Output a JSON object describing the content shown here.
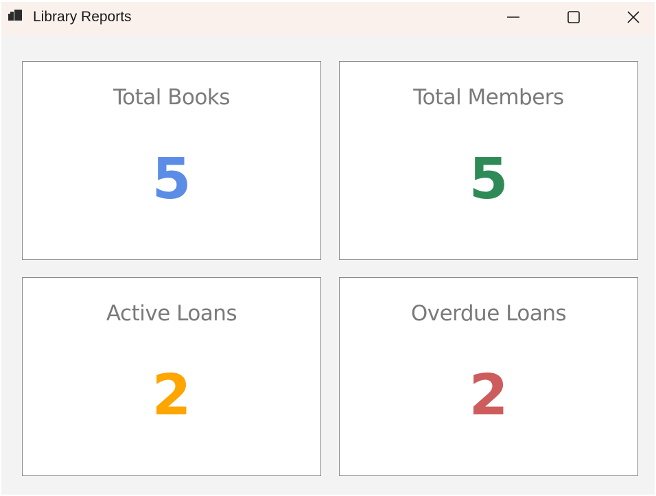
{
  "window": {
    "title": "Library Reports",
    "icon": "app-icon"
  },
  "titlebar_buttons": {
    "minimize_icon": "minimize-icon",
    "maximize_icon": "maximize-icon",
    "close_icon": "close-icon"
  },
  "cards": [
    {
      "label": "Total Books",
      "value": "5",
      "color": "#5b8de6"
    },
    {
      "label": "Total Members",
      "value": "5",
      "color": "#2e8b57"
    },
    {
      "label": "Active Loans",
      "value": "2",
      "color": "#ffa500"
    },
    {
      "label": "Overdue Loans",
      "value": "2",
      "color": "#cd5c5c"
    }
  ]
}
